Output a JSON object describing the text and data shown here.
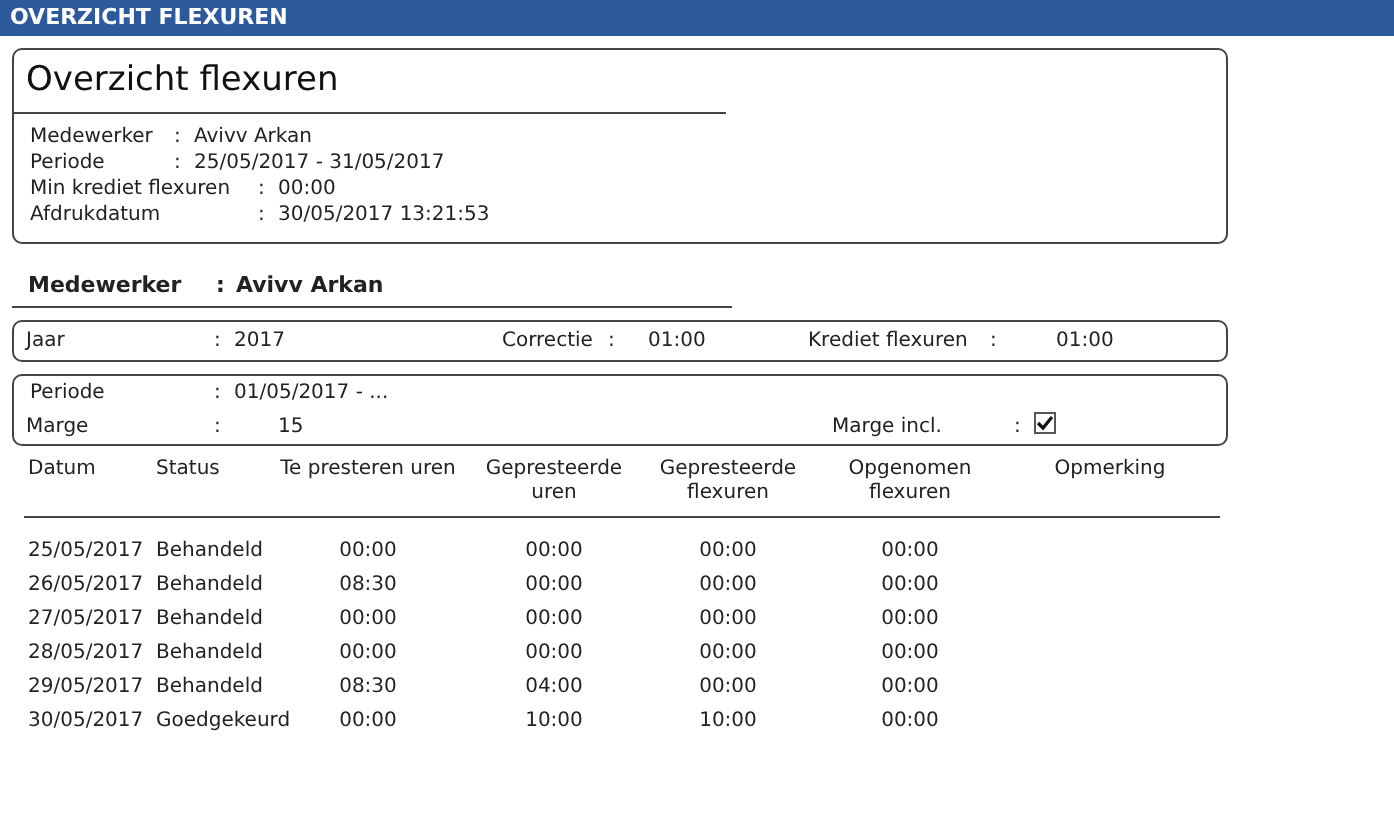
{
  "header": {
    "title": "OVERZICHT FLEXUREN"
  },
  "summary": {
    "title": "Overzicht flexuren",
    "fields": [
      {
        "label": "Medewerker",
        "separator": ":",
        "value": "Avivv Arkan"
      },
      {
        "label": "Periode",
        "separator": ":",
        "value": "25/05/2017 -  31/05/2017"
      },
      {
        "label": "Min krediet flexuren",
        "separator": ":",
        "value": "00:00"
      },
      {
        "label": "Afdrukdatum",
        "separator": ":",
        "value": "30/05/2017 13:21:53"
      }
    ]
  },
  "employee": {
    "label": "Medewerker",
    "separator": ":",
    "value": "Avivv Arkan"
  },
  "year_panel": {
    "jaar": {
      "label": "Jaar",
      "separator": ":",
      "value": "2017"
    },
    "correctie": {
      "label": "Correctie",
      "separator": ":",
      "value": "01:00"
    },
    "krediet": {
      "label": "Krediet flexuren",
      "separator": ":",
      "value": "01:00"
    }
  },
  "period_panel": {
    "periode": {
      "label": "Periode",
      "separator": ":",
      "value": "01/05/2017 -  ..."
    },
    "marge": {
      "label": "Marge",
      "separator": ":",
      "value": "15"
    },
    "marge_incl": {
      "label": "Marge incl.",
      "separator": ":",
      "checked": true
    }
  },
  "table": {
    "columns": [
      "Datum",
      "Status",
      "Te presteren uren",
      "Gepresteerde uren",
      "Gepresteerde flexuren",
      "Opgenomen flexuren",
      "Opmerking"
    ],
    "rows": [
      [
        "25/05/2017",
        "Behandeld",
        "00:00",
        "00:00",
        "00:00",
        "00:00"
      ],
      [
        "26/05/2017",
        "Behandeld",
        "08:30",
        "00:00",
        "00:00",
        "00:00"
      ],
      [
        "27/05/2017",
        "Behandeld",
        "00:00",
        "00:00",
        "00:00",
        "00:00"
      ],
      [
        "28/05/2017",
        "Behandeld",
        "00:00",
        "00:00",
        "00:00",
        "00:00"
      ],
      [
        "29/05/2017",
        "Behandeld",
        "08:30",
        "04:00",
        "00:00",
        "00:00"
      ],
      [
        "30/05/2017",
        "Goedgekeurd",
        "00:00",
        "10:00",
        "10:00",
        "00:00"
      ]
    ]
  }
}
